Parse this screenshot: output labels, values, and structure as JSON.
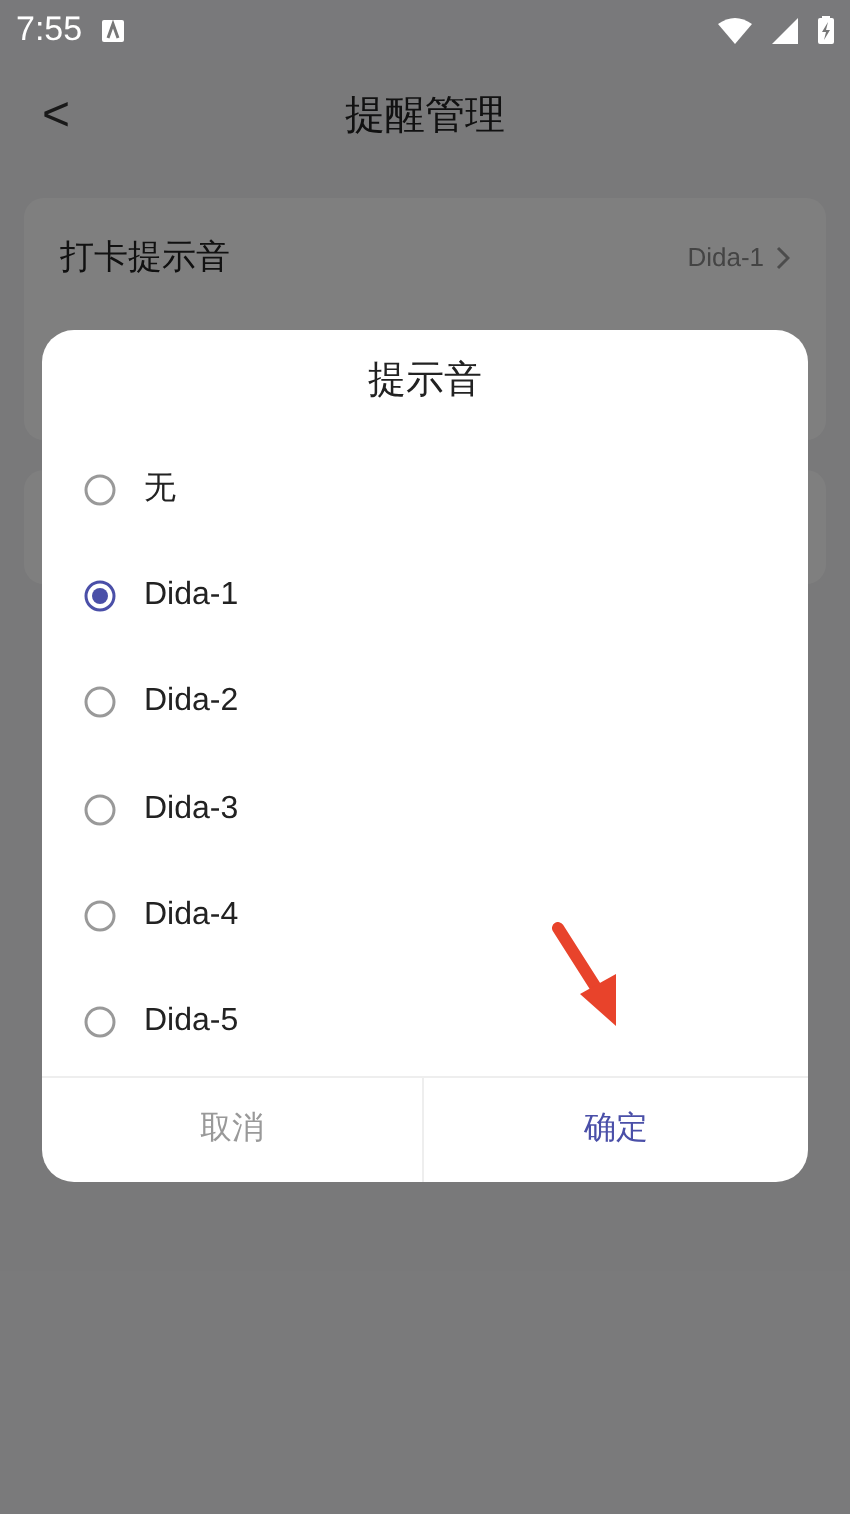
{
  "status_bar": {
    "time": "7:55"
  },
  "header": {
    "back": "<",
    "title": "提醒管理"
  },
  "settings": [
    {
      "label": "打卡提示音",
      "value": "Dida-1"
    }
  ],
  "dialog": {
    "title": "提示音",
    "options": [
      {
        "label": "无",
        "selected": false
      },
      {
        "label": "Dida-1",
        "selected": true
      },
      {
        "label": "Dida-2",
        "selected": false
      },
      {
        "label": "Dida-3",
        "selected": false
      },
      {
        "label": "Dida-4",
        "selected": false
      },
      {
        "label": "Dida-5",
        "selected": false
      }
    ],
    "cancel": "取消",
    "confirm": "确定"
  }
}
